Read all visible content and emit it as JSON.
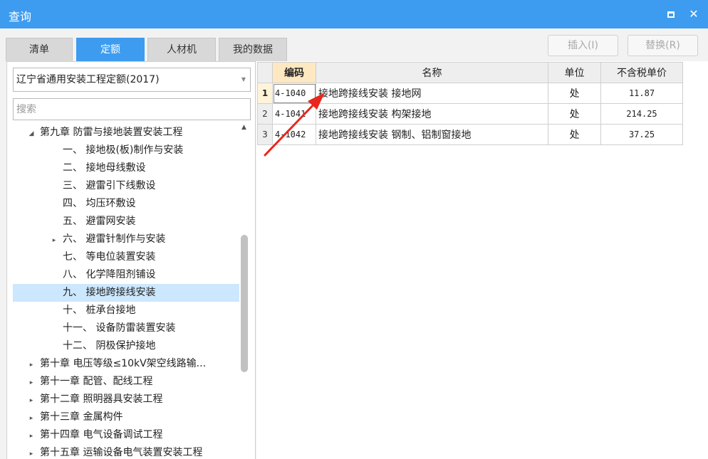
{
  "window": {
    "title": "查询",
    "maximize_icon": "maximize-icon",
    "close_icon": "close-icon"
  },
  "tabs": [
    {
      "label": "清单",
      "active": false
    },
    {
      "label": "定额",
      "active": true
    },
    {
      "label": "人材机",
      "active": false
    },
    {
      "label": "我的数据",
      "active": false
    }
  ],
  "toolbar": {
    "insert_label": "插入(I)",
    "replace_label": "替换(R)",
    "insert_enabled": false,
    "replace_enabled": false
  },
  "library": {
    "selected": "辽宁省通用安装工程定额(2017)"
  },
  "search": {
    "placeholder": "搜索",
    "value": ""
  },
  "tree": {
    "items": [
      {
        "toggle": "◢",
        "label": "第九章 防雷与接地装置安装工程",
        "level": 1,
        "expanded": true
      },
      {
        "toggle": "",
        "label": "一、 接地极(板)制作与安装",
        "level": 2
      },
      {
        "toggle": "",
        "label": "二、 接地母线敷设",
        "level": 2
      },
      {
        "toggle": "",
        "label": "三、 避雷引下线敷设",
        "level": 2
      },
      {
        "toggle": "",
        "label": "四、 均压环敷设",
        "level": 2
      },
      {
        "toggle": "",
        "label": "五、 避雷网安装",
        "level": 2
      },
      {
        "toggle": "▸",
        "label": "六、 避雷针制作与安装",
        "level": 2
      },
      {
        "toggle": "",
        "label": "七、 等电位装置安装",
        "level": 2
      },
      {
        "toggle": "",
        "label": "八、 化学降阻剂铺设",
        "level": 2
      },
      {
        "toggle": "",
        "label": "九、 接地跨接线安装",
        "level": 2,
        "selected": true
      },
      {
        "toggle": "",
        "label": "十、 桩承台接地",
        "level": 2
      },
      {
        "toggle": "",
        "label": "十一、 设备防雷装置安装",
        "level": 2
      },
      {
        "toggle": "",
        "label": "十二、 阴极保护接地",
        "level": 2
      },
      {
        "toggle": "▸",
        "label": "第十章 电压等级≤10kV架空线路输...",
        "level": 1
      },
      {
        "toggle": "▸",
        "label": "第十一章 配管、配线工程",
        "level": 1
      },
      {
        "toggle": "▸",
        "label": "第十二章 照明器具安装工程",
        "level": 1
      },
      {
        "toggle": "▸",
        "label": "第十三章 金属构件",
        "level": 1
      },
      {
        "toggle": "▸",
        "label": "第十四章 电气设备调试工程",
        "level": 1
      },
      {
        "toggle": "▸",
        "label": "第十五章 运输设备电气装置安装工程",
        "level": 1
      }
    ]
  },
  "table": {
    "headers": {
      "code": "编码",
      "name": "名称",
      "unit": "单位",
      "price": "不含税单价"
    },
    "rows": [
      {
        "num": "1",
        "code": "4-1040",
        "name": "接地跨接线安装 接地网",
        "unit": "处",
        "price": "11.87"
      },
      {
        "num": "2",
        "code": "4-1041",
        "name": "接地跨接线安装 构架接地",
        "unit": "处",
        "price": "214.25"
      },
      {
        "num": "3",
        "code": "4-1042",
        "name": "接地跨接线安装 钢制、铝制窗接地",
        "unit": "处",
        "price": "37.25"
      }
    ]
  },
  "annotation": {
    "color": "#e8261c"
  },
  "colors": {
    "accent": "#3d9cf0",
    "selection": "#cce8ff",
    "header_highlight": "#fde8c2"
  }
}
